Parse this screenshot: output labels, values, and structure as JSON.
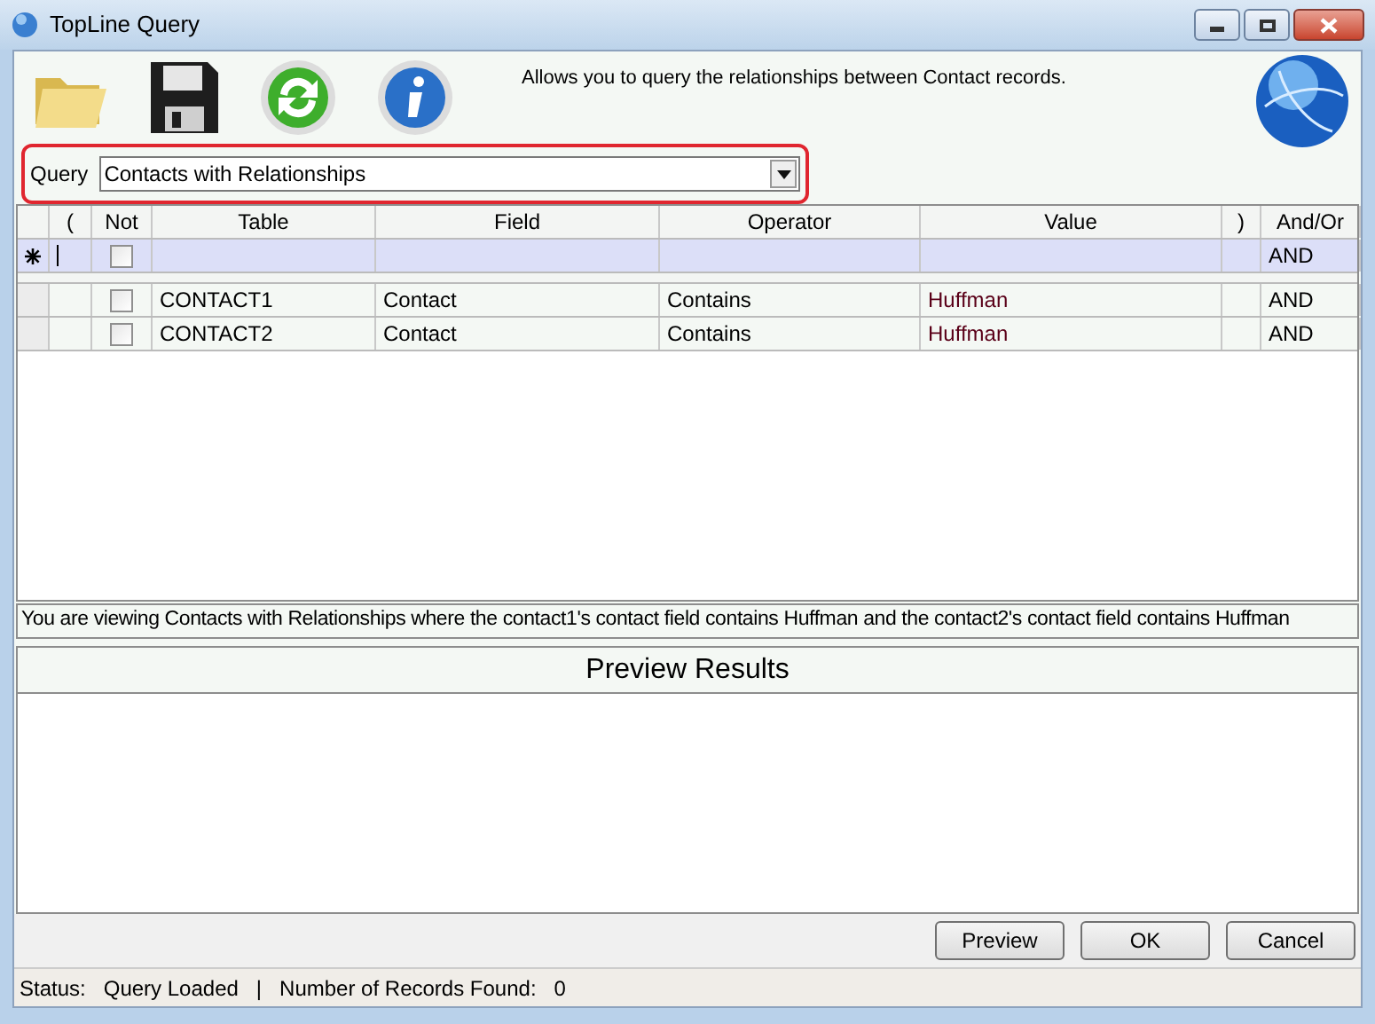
{
  "window": {
    "title": "TopLine Query"
  },
  "header": {
    "description": "Allows you to query the relationships between Contact records."
  },
  "query": {
    "label": "Query",
    "value": "Contacts with Relationships"
  },
  "grid": {
    "columns": [
      "(",
      "Not",
      "Table",
      "Field",
      "Operator",
      "Value",
      ")",
      "And/Or"
    ],
    "new_row": {
      "not_checked": false,
      "and_or": "AND"
    },
    "rows": [
      {
        "not_checked": false,
        "table": "CONTACT1",
        "field": "Contact",
        "operator": "Contains",
        "value": "Huffman",
        "and_or": "AND"
      },
      {
        "not_checked": false,
        "table": "CONTACT2",
        "field": "Contact",
        "operator": "Contains",
        "value": "Huffman",
        "and_or": "AND"
      }
    ]
  },
  "summary": "You are viewing Contacts with Relationships where the contact1's contact field contains Huffman and the contact2's contact field contains Huffman",
  "preview": {
    "title": "Preview Results"
  },
  "buttons": [
    "Preview",
    "OK",
    "Cancel"
  ],
  "status_bar": {
    "label": "Status:",
    "status": "Query Loaded",
    "separator": "|",
    "count_label": "Number of Records Found:",
    "count": "0"
  }
}
